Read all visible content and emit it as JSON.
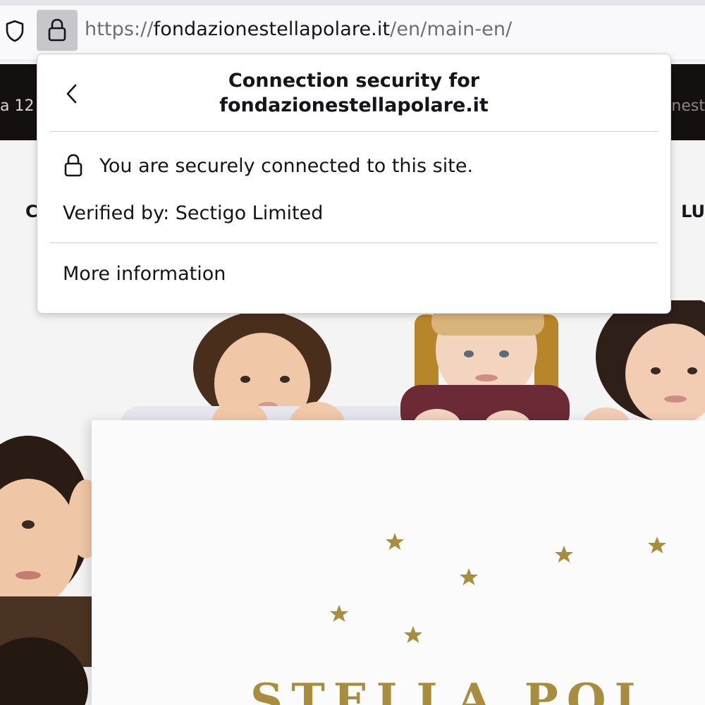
{
  "url": {
    "scheme": "https://",
    "host": "fondazionestellapolare.it",
    "path": "/en/main-en/"
  },
  "page": {
    "top_bar_left": "a 12",
    "top_bar_right": "nest",
    "nav_left": "C",
    "nav_right": "LU",
    "banner_title": "STELLA POL"
  },
  "panel": {
    "title_line1": "Connection security for",
    "title_line2": "fondazionestellapolare.it",
    "secure_text": "You are securely connected to this site.",
    "verified_by": "Verified by: Sectigo Limited",
    "more_info": "More information"
  },
  "icons": {
    "tracking_protection": "shield-icon",
    "site_security": "lock-icon",
    "back": "chevron-left-icon",
    "secure": "lock-icon",
    "stars": "star-icon"
  },
  "colors": {
    "star_gold": "#a88d3e",
    "lock_button_bg": "#c7c7cb",
    "top_bar": "#151010"
  }
}
